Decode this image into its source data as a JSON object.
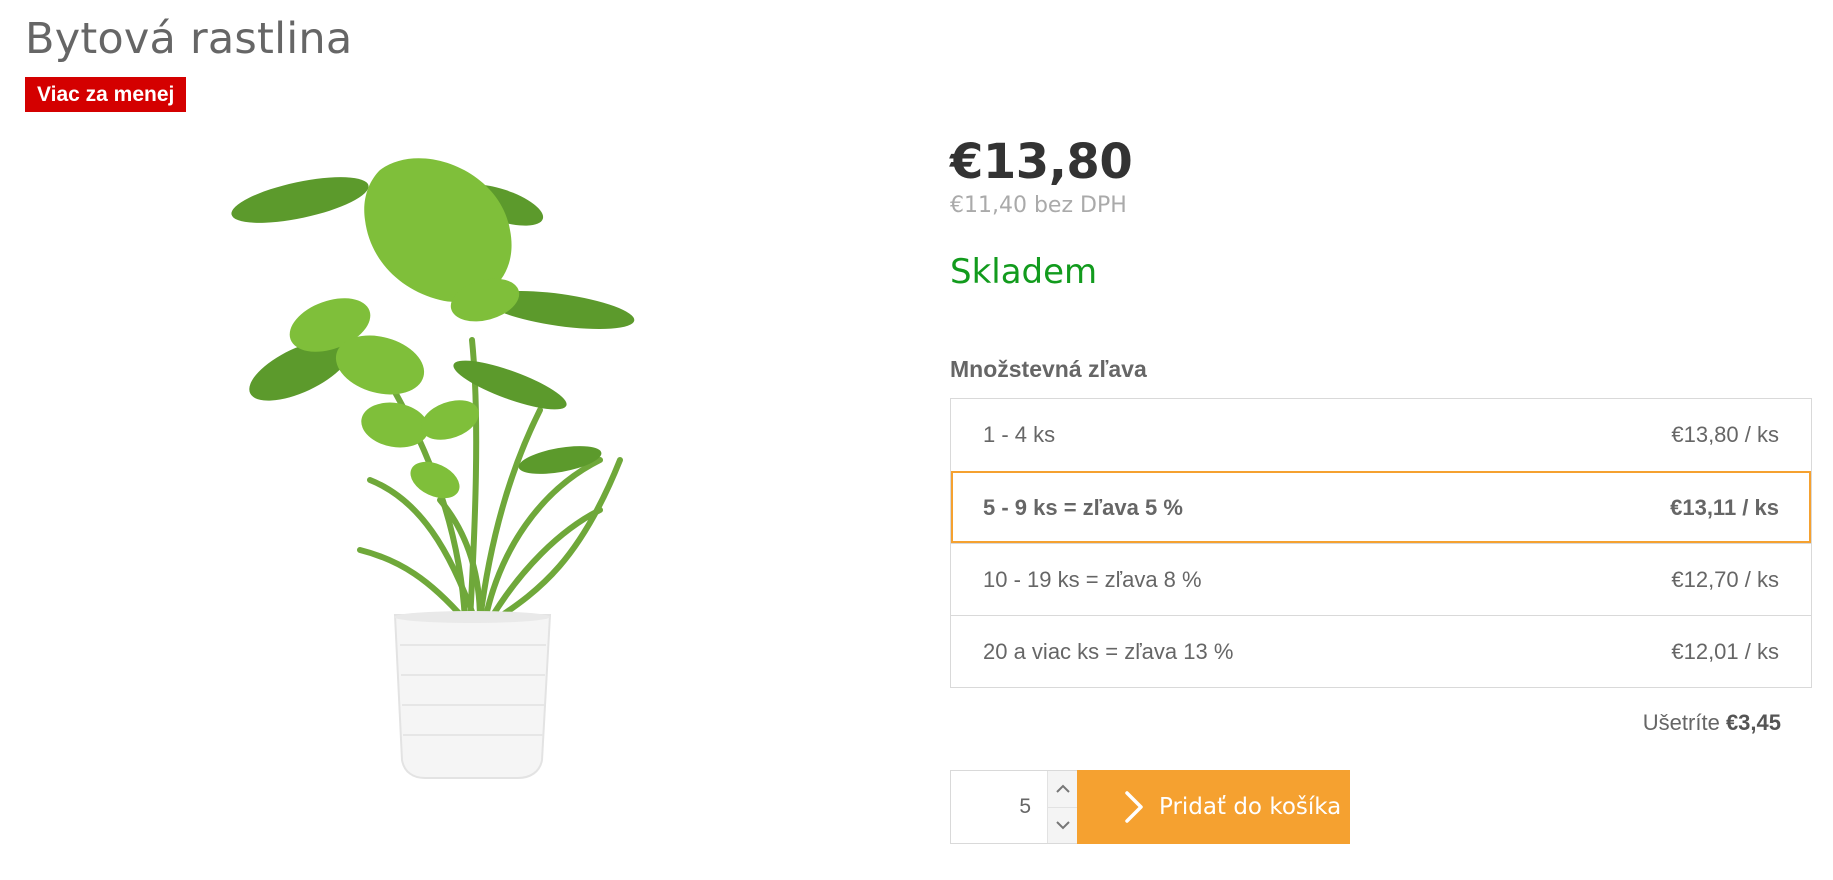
{
  "product": {
    "title": "Bytová rastlina",
    "badge": "Viac za menej",
    "price": "€13,80",
    "price_net": "€11,40 bez DPH",
    "stock": "Skladem"
  },
  "discount": {
    "heading": "Množstevná zľava",
    "rows": [
      {
        "label": "1 - 4 ks",
        "price": "€13,80 / ks",
        "active": false
      },
      {
        "label": "5 - 9 ks = zľava 5 %",
        "price": "€13,11 / ks",
        "active": true
      },
      {
        "label": "10 - 19 ks = zľava 8 %",
        "price": "€12,70 / ks",
        "active": false
      },
      {
        "label": "20 a viac ks = zľava 13 %",
        "price": "€12,01 / ks",
        "active": false
      }
    ],
    "savings_label": "Ušetríte",
    "savings_value": "€3,45"
  },
  "cart": {
    "quantity": "5",
    "button_label": "Pridať do košíka"
  },
  "icons": {
    "stepper_up": "chevron-up-icon",
    "stepper_down": "chevron-down-icon",
    "cart_arrow": "chevron-right-icon"
  },
  "colors": {
    "badge": "#d40000",
    "stock": "#129b1d",
    "accent": "#f5a130"
  }
}
